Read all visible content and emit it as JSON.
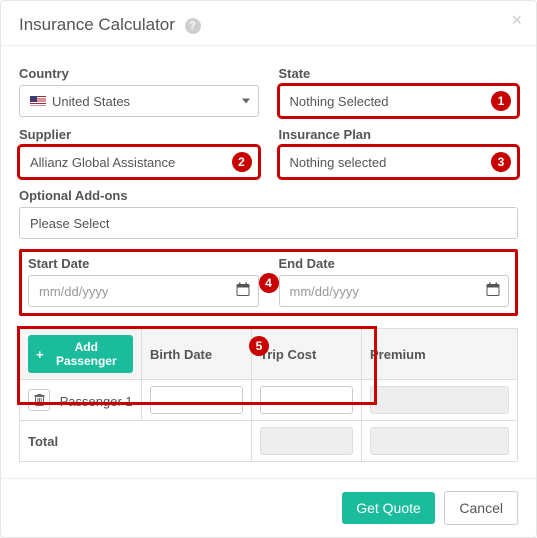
{
  "header": {
    "title": "Insurance Calculator"
  },
  "markers": {
    "m1": "1",
    "m2": "2",
    "m3": "3",
    "m4": "4",
    "m5": "5"
  },
  "fields": {
    "country": {
      "label": "Country",
      "value": "United States"
    },
    "state": {
      "label": "State",
      "value": "Nothing Selected"
    },
    "supplier": {
      "label": "Supplier",
      "value": "Allianz Global Assistance"
    },
    "plan": {
      "label": "Insurance Plan",
      "value": "Nothing selected"
    },
    "addons": {
      "label": "Optional Add-ons",
      "value": "Please Select"
    },
    "start": {
      "label": "Start Date",
      "placeholder": "mm/dd/yyyy"
    },
    "end": {
      "label": "End Date",
      "placeholder": "mm/dd/yyyy"
    }
  },
  "table": {
    "add_label": "Add Passenger",
    "col_birth": "Birth Date",
    "col_cost": "Trip Cost",
    "col_premium": "Premium",
    "row1_label": "Passenger 1",
    "total_label": "Total"
  },
  "footer": {
    "quote": "Get Quote",
    "cancel": "Cancel"
  }
}
